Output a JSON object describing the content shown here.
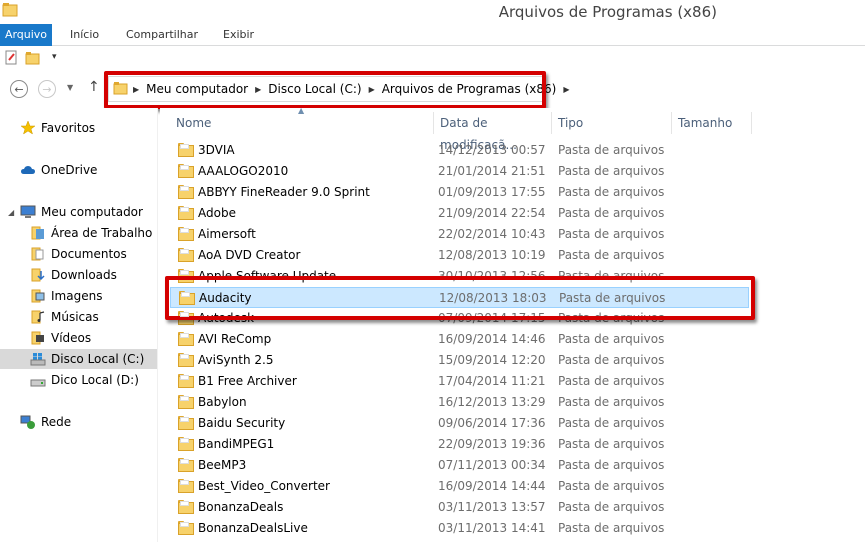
{
  "window": {
    "title": "Arquivos de Programas (x86)"
  },
  "ribbon": {
    "tabs": [
      "Arquivo",
      "Início",
      "Compartilhar",
      "Exibir"
    ],
    "active_color": "#1979ca"
  },
  "address": {
    "crumbs": [
      "Meu computador",
      "Disco Local (C:)",
      "Arquivos de Programas (x86)"
    ]
  },
  "nav": {
    "favorites": "Favoritos",
    "onedrive": "OneDrive",
    "computer": "Meu computador",
    "computer_children": [
      "Área de Trabalho",
      "Documentos",
      "Downloads",
      "Imagens",
      "Músicas",
      "Vídeos",
      "Disco Local (C:)",
      "Dico Local (D:)"
    ],
    "network": "Rede"
  },
  "columns": {
    "name": "Nome",
    "date": "Data de modificaçã...",
    "type": "Tipo",
    "size": "Tamanho"
  },
  "files": [
    {
      "name": "3DVIA",
      "date": "14/12/2013 00:57",
      "type": "Pasta de arquivos"
    },
    {
      "name": "AAALOGO2010",
      "date": "21/01/2014 21:51",
      "type": "Pasta de arquivos"
    },
    {
      "name": "ABBYY FineReader 9.0 Sprint",
      "date": "01/09/2013 17:55",
      "type": "Pasta de arquivos"
    },
    {
      "name": "Adobe",
      "date": "21/09/2014 22:54",
      "type": "Pasta de arquivos"
    },
    {
      "name": "Aimersoft",
      "date": "22/02/2014 10:43",
      "type": "Pasta de arquivos"
    },
    {
      "name": "AoA DVD Creator",
      "date": "12/08/2013 10:19",
      "type": "Pasta de arquivos"
    },
    {
      "name": "Apple Software Update",
      "date": "30/10/2013 12:56",
      "type": "Pasta de arquivos"
    },
    {
      "name": "Audacity",
      "date": "12/08/2013 18:03",
      "type": "Pasta de arquivos"
    },
    {
      "name": "Autodesk",
      "date": "07/09/2014 17:15",
      "type": "Pasta de arquivos"
    },
    {
      "name": "AVI ReComp",
      "date": "16/09/2014 14:46",
      "type": "Pasta de arquivos"
    },
    {
      "name": "AviSynth 2.5",
      "date": "15/09/2014 12:20",
      "type": "Pasta de arquivos"
    },
    {
      "name": "B1 Free Archiver",
      "date": "17/04/2014 11:21",
      "type": "Pasta de arquivos"
    },
    {
      "name": "Babylon",
      "date": "16/12/2013 13:29",
      "type": "Pasta de arquivos"
    },
    {
      "name": "Baidu Security",
      "date": "09/06/2014 17:36",
      "type": "Pasta de arquivos"
    },
    {
      "name": "BandiMPEG1",
      "date": "22/09/2013 19:36",
      "type": "Pasta de arquivos"
    },
    {
      "name": "BeeMP3",
      "date": "07/11/2013 00:34",
      "type": "Pasta de arquivos"
    },
    {
      "name": "Best_Video_Converter",
      "date": "16/09/2014 14:44",
      "type": "Pasta de arquivos"
    },
    {
      "name": "BonanzaDeals",
      "date": "03/11/2013 13:57",
      "type": "Pasta de arquivos"
    },
    {
      "name": "BonanzaDealsLive",
      "date": "03/11/2013 14:41",
      "type": "Pasta de arquivos"
    }
  ],
  "selected_file": "Audacity",
  "highlight_color": "#d40000"
}
